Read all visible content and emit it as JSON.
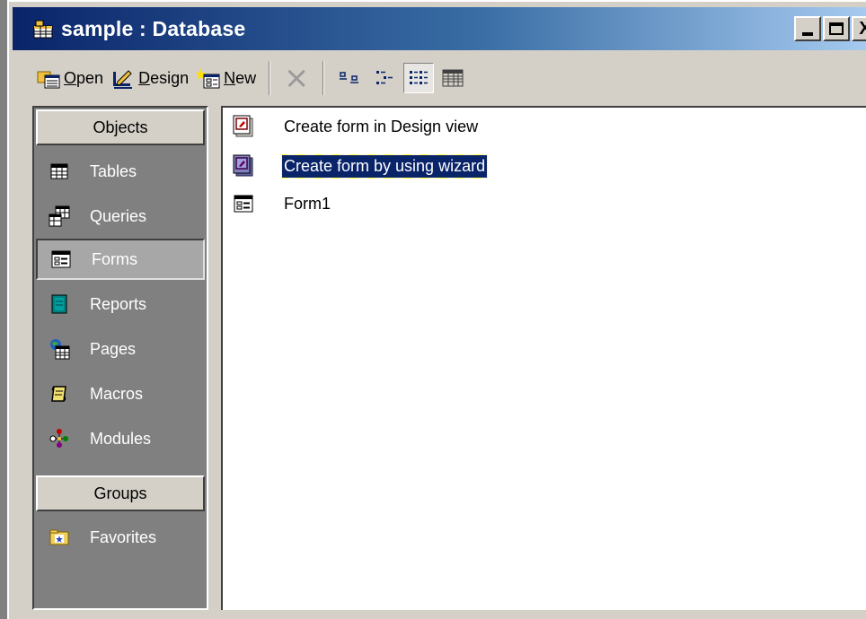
{
  "window": {
    "title": "sample : Database",
    "controls": {
      "minimize": "_",
      "maximize": "□",
      "close": "X"
    }
  },
  "toolbar": {
    "open": {
      "mnemonic": "O",
      "rest": "pen"
    },
    "design": {
      "mnemonic": "D",
      "rest": "esign"
    },
    "new": {
      "mnemonic": "N",
      "rest": "ew"
    },
    "delete_icon": "×"
  },
  "objects_bar": {
    "objects_header": "Objects",
    "items": [
      {
        "label": "Tables",
        "icon": "table-icon"
      },
      {
        "label": "Queries",
        "icon": "query-icon"
      },
      {
        "label": "Forms",
        "icon": "form-icon",
        "selected": true
      },
      {
        "label": "Reports",
        "icon": "report-icon"
      },
      {
        "label": "Pages",
        "icon": "page-icon"
      },
      {
        "label": "Macros",
        "icon": "macro-icon"
      },
      {
        "label": "Modules",
        "icon": "module-icon"
      }
    ],
    "groups_header": "Groups",
    "groups": [
      {
        "label": "Favorites",
        "icon": "favorites-folder-icon"
      }
    ]
  },
  "list": {
    "items": [
      {
        "label": "Create form in Design view",
        "icon": "design-shortcut-icon"
      },
      {
        "label": "Create form by using wizard",
        "icon": "wizard-shortcut-icon",
        "selected": true
      },
      {
        "label": "Form1",
        "icon": "form-icon"
      }
    ]
  },
  "colors": {
    "title_start": "#0a246a",
    "title_end": "#a6caf0",
    "chrome": "#d4d0c8",
    "objbar_bg": "#808080",
    "selection": "#0a246a"
  }
}
